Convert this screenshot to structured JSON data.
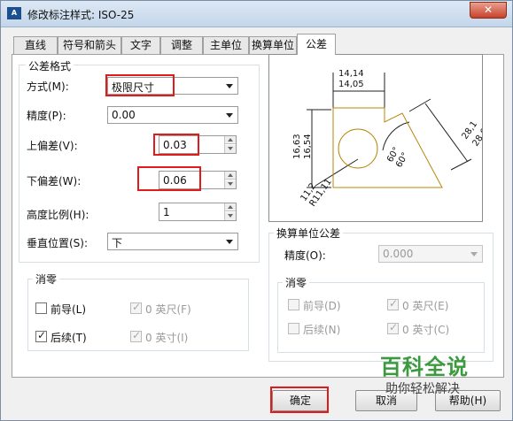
{
  "window": {
    "title": "修改标注样式: ISO-25",
    "close_glyph": "✕",
    "icon_text": "A"
  },
  "tabs": [
    {
      "label": "直线"
    },
    {
      "label": "符号和箭头"
    },
    {
      "label": "文字"
    },
    {
      "label": "调整"
    },
    {
      "label": "主单位"
    },
    {
      "label": "换算单位"
    },
    {
      "label": "公差"
    }
  ],
  "tolerance_format": {
    "title": "公差格式",
    "method_label": "方式(M):",
    "method_value": "极限尺寸",
    "precision_label": "精度(P):",
    "precision_value": "0.00",
    "upper_label": "上偏差(V):",
    "upper_value": "0.03",
    "lower_label": "下偏差(W):",
    "lower_value": "0.06",
    "height_label": "高度比例(H):",
    "height_value": "1",
    "vertical_label": "垂直位置(S):",
    "vertical_value": "下"
  },
  "zero_suppression": {
    "title": "消零",
    "leading": "前导(L)",
    "trailing": "后续(T)",
    "feet": "0 英尺(F)",
    "inches": "0 英寸(I)"
  },
  "alt_unit": {
    "title": "换算单位公差",
    "precision_label": "精度(O):",
    "precision_value": "0.000",
    "zero_title": "消零",
    "leading": "前导(D)",
    "trailing": "后续(N)",
    "feet": "0 英尺(E)",
    "inches": "0 英寸(C)"
  },
  "preview": {
    "dim_top_1": "14,14",
    "dim_top_2": "14,05",
    "dim_left_1": "16,63",
    "dim_left_2": "16,54",
    "dim_right_1": "28,1",
    "dim_right_2": "28,01",
    "angle_1": "60°",
    "angle_2": "60°",
    "radius_1": "11,2",
    "radius_2": "R11,11"
  },
  "buttons": {
    "ok": "确定",
    "cancel": "取消",
    "help": "帮助(H)"
  },
  "watermark": {
    "title": "百科全说",
    "subtitle": "助你轻松解决"
  }
}
